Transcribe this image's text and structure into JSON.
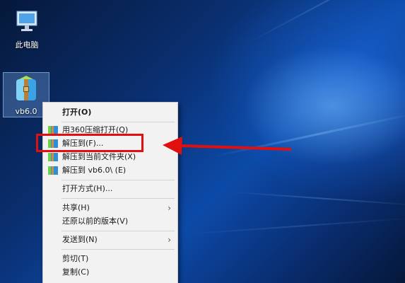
{
  "desktop": {
    "icons": [
      {
        "label": "此电脑"
      },
      {
        "label": "vb6.0"
      }
    ]
  },
  "context_menu": {
    "items": [
      {
        "label": "打开(O)",
        "icon": "none",
        "bold": true
      },
      {
        "label": "用360压缩打开(Q)",
        "icon": "archive-icon"
      },
      {
        "label": "解压到(F)...",
        "icon": "archive-icon"
      },
      {
        "label": "解压到当前文件夹(X)",
        "icon": "archive-icon"
      },
      {
        "label": "解压到 vb6.0\\ (E)",
        "icon": "archive-icon"
      },
      {
        "label": "打开方式(H)..."
      },
      {
        "label": "共享(H)",
        "submenu": true
      },
      {
        "label": "还原以前的版本(V)"
      },
      {
        "label": "发送到(N)",
        "submenu": true
      },
      {
        "label": "剪切(T)"
      },
      {
        "label": "复制(C)"
      }
    ]
  },
  "annotation": {
    "highlight_color": "#e01010",
    "target": "解压到(F)..."
  }
}
